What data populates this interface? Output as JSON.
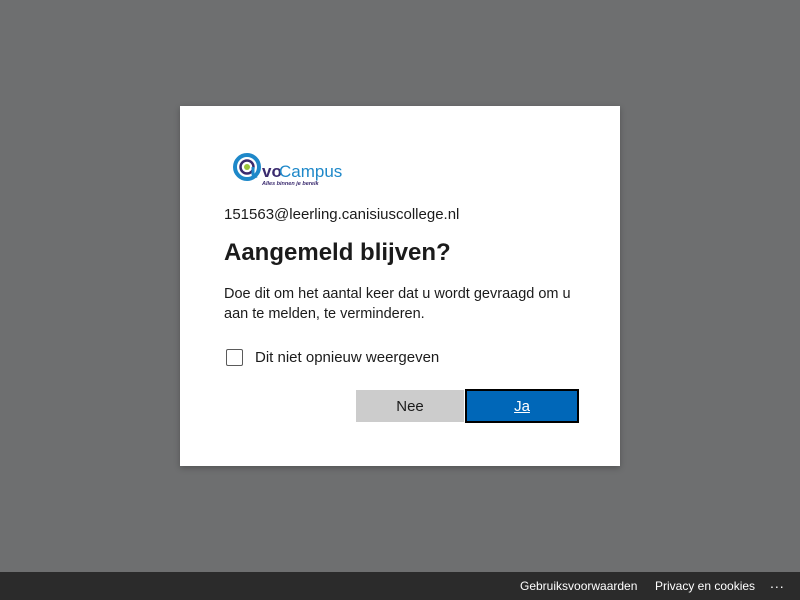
{
  "logo": {
    "brand_prefix": "vo",
    "brand_name": "Campus",
    "tagline": "Alles binnen je bereik"
  },
  "dialog": {
    "account": "151563@leerling.canisiuscollege.nl",
    "title": "Aangemeld blijven?",
    "description": "Doe dit om het aantal keer dat u wordt gevraagd om u aan te melden, te verminderen.",
    "checkbox_label": "Dit niet opnieuw weergeven",
    "checkbox_checked": false,
    "no_label": "Nee",
    "yes_label": "Ja"
  },
  "footer": {
    "terms_label": "Gebruiksvoorwaarden",
    "privacy_label": "Privacy en cookies",
    "more_label": "..."
  },
  "colors": {
    "background": "#6e6f70",
    "primary_button": "#0067b8",
    "secondary_button": "#cccccc",
    "footer": "#2b2b2b",
    "logo_blue": "#1e88c9",
    "logo_green": "#9bc43a",
    "logo_purple": "#3a2a6e"
  },
  "icons": {
    "logo": "at-sign-logo-icon",
    "more": "ellipsis-icon"
  }
}
